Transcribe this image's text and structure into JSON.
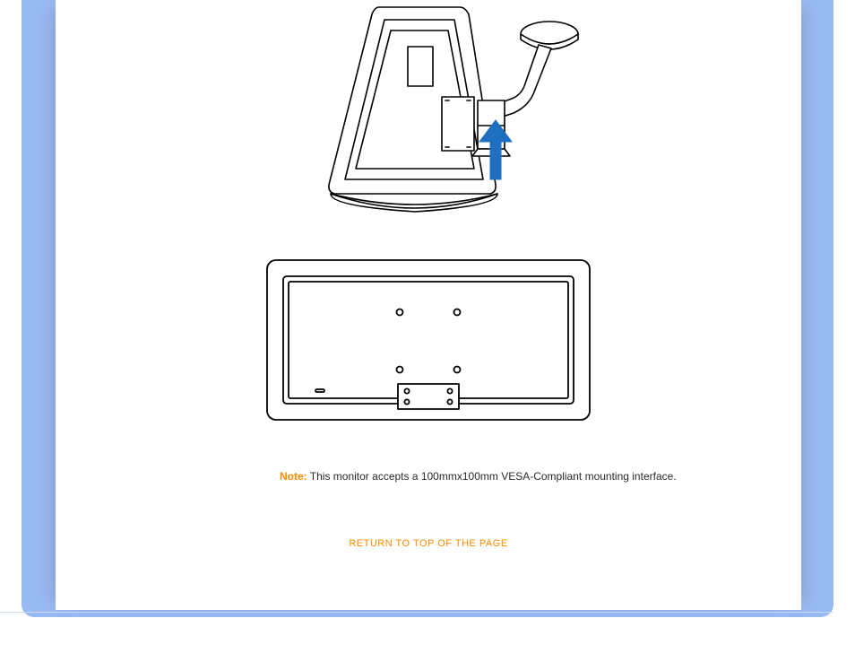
{
  "note": {
    "label": "Note:",
    "text": " This monitor accepts a 100mmx100mm VESA-Compliant mounting interface."
  },
  "return_link": "RETURN TO TOP OF THE PAGE",
  "icons": {
    "top_diagram": "monitor-base-detach-diagram",
    "bottom_diagram": "monitor-rear-vesa-diagram",
    "arrow": "up-arrow-icon"
  },
  "colors": {
    "accent": "#ff8a00",
    "frame": "#99b9f2",
    "arrow": "#1f6fc0"
  }
}
